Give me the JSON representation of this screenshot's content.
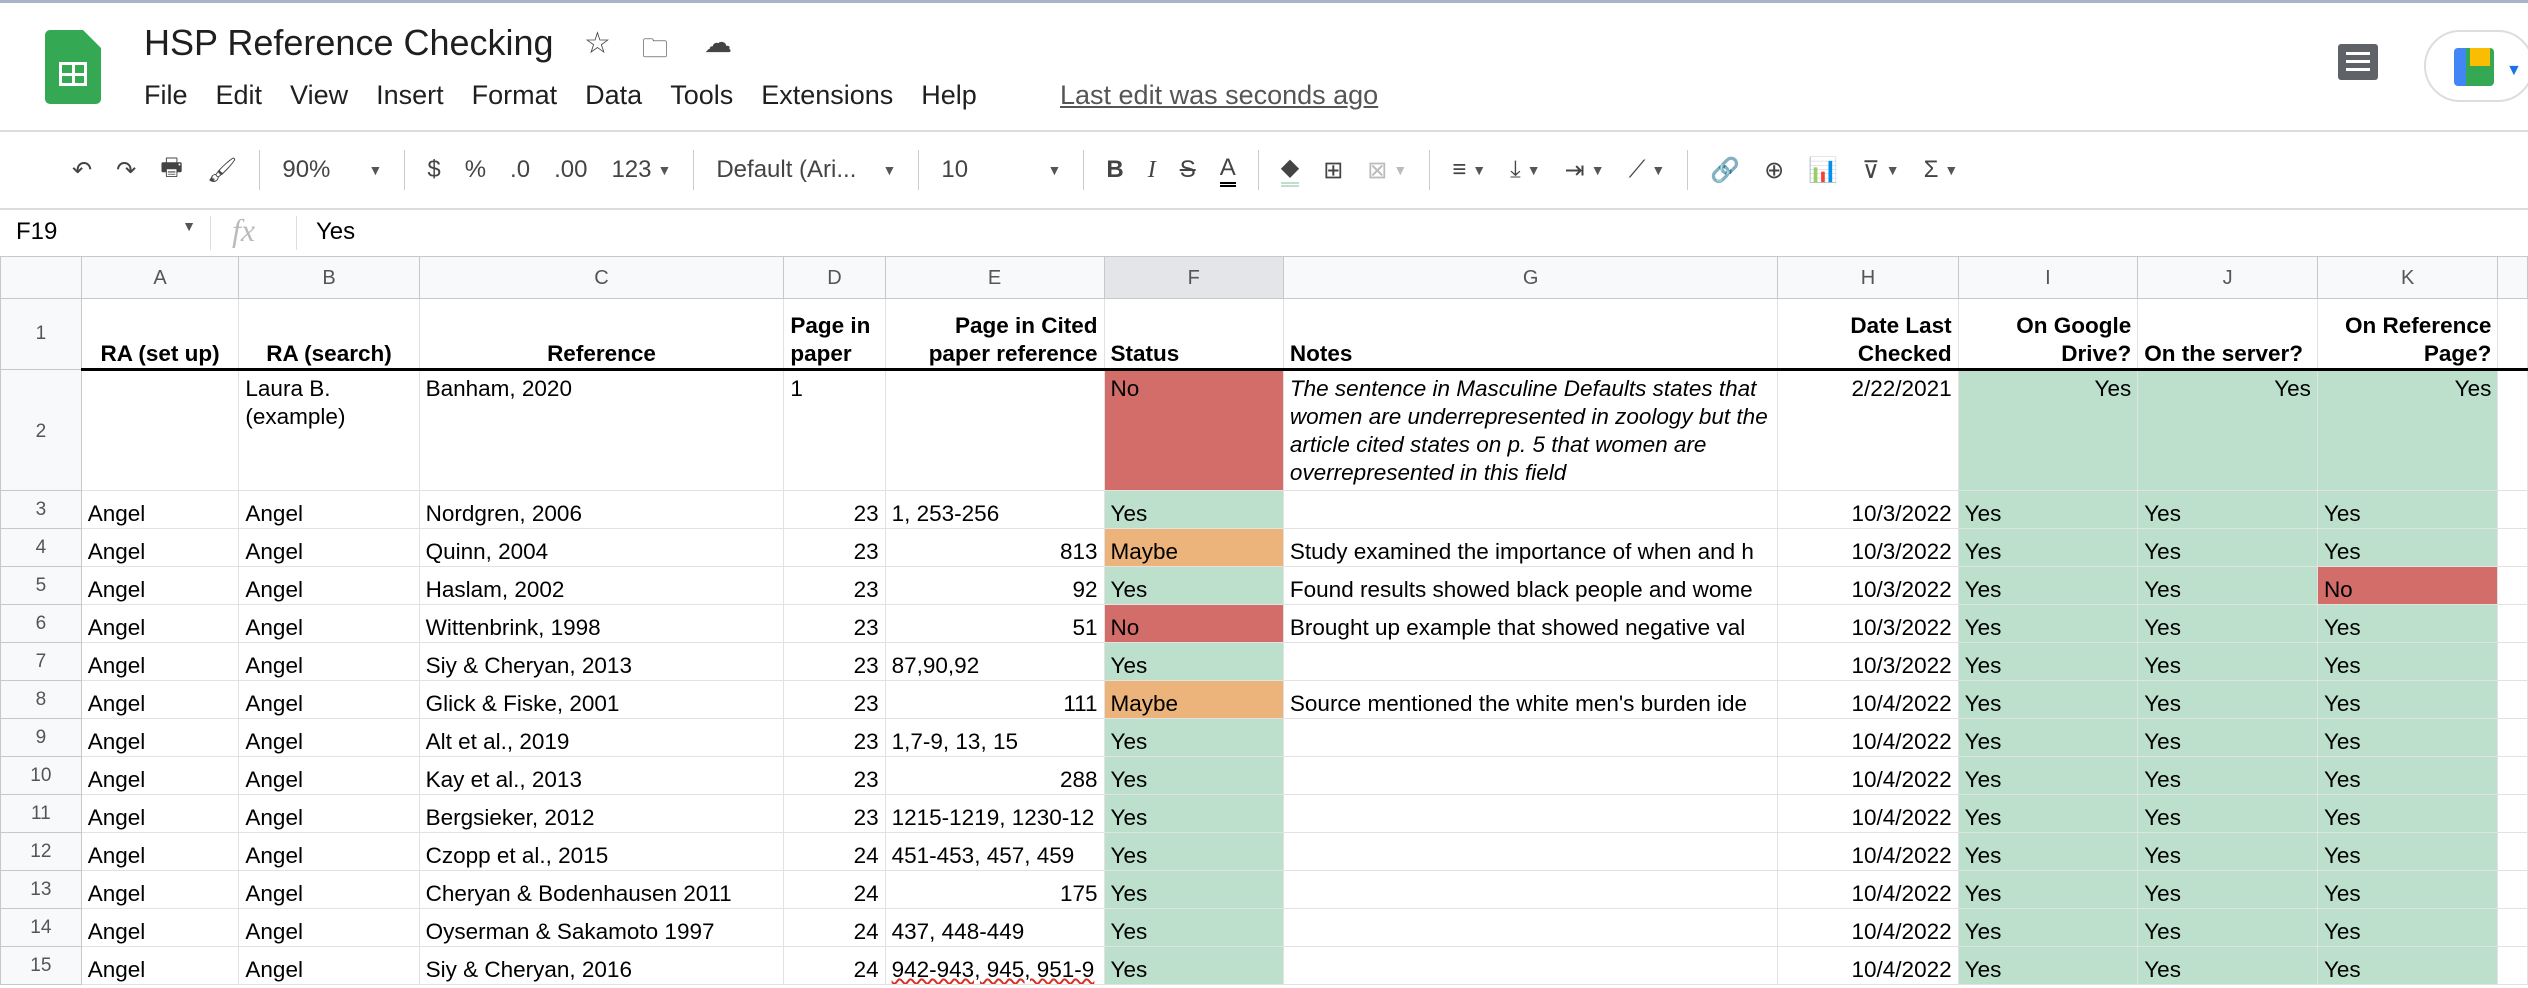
{
  "doc": {
    "title": "HSP Reference Checking",
    "last_edit": "Last edit was seconds ago"
  },
  "menu": [
    "File",
    "Edit",
    "View",
    "Insert",
    "Format",
    "Data",
    "Tools",
    "Extensions",
    "Help"
  ],
  "toolbar": {
    "zoom": "90%",
    "currency": "$",
    "percent": "%",
    "dec_less": ".0",
    "dec_more": ".00",
    "format_more": "123",
    "font": "Default (Ari...",
    "font_size": "10",
    "bold": "B",
    "italic": "I",
    "strike": "S",
    "text_color": "A"
  },
  "formula_bar": {
    "cell_ref": "F19",
    "fx": "fx",
    "value": "Yes"
  },
  "colors": {
    "green": "#bde0cd",
    "red": "#d36d6a",
    "orange": "#ecb47b"
  },
  "columns": [
    "A",
    "B",
    "C",
    "D",
    "E",
    "F",
    "G",
    "H",
    "I",
    "J",
    "K",
    ""
  ],
  "header_row": {
    "num": "1",
    "cells": [
      "RA (set up)",
      "RA (search)",
      "Reference",
      "Page in paper",
      "Page in Cited paper reference",
      "Status",
      "Notes",
      "Date Last Checked",
      "On Google Drive?",
      "On the server?",
      "On Reference Page?",
      ""
    ]
  },
  "example_row": {
    "num": "2",
    "cells": [
      "",
      "Laura B. (example)",
      "Banham, 2020",
      "1",
      "",
      "No",
      "The sentence in Masculine Defaults states that women are underrepresented in zoology but the article cited states on p. 5 that women are overrepresented in this field",
      "2/22/2021",
      "Yes",
      "Yes",
      "Yes",
      ""
    ]
  },
  "rows": [
    {
      "num": "3",
      "cells": [
        "Angel",
        "Angel",
        "Nordgren, 2006",
        "23",
        "1, 253-256",
        "Yes",
        "",
        "10/3/2022",
        "Yes",
        "Yes",
        "Yes"
      ]
    },
    {
      "num": "4",
      "cells": [
        "Angel",
        "Angel",
        "Quinn, 2004",
        "23",
        "813",
        "Maybe",
        "Study examined the importance of when and h",
        "10/3/2022",
        "Yes",
        "Yes",
        "Yes"
      ]
    },
    {
      "num": "5",
      "cells": [
        "Angel",
        "Angel",
        "Haslam, 2002",
        "23",
        "92",
        "Yes",
        "Found results showed black people and wome",
        "10/3/2022",
        "Yes",
        "Yes",
        "No"
      ]
    },
    {
      "num": "6",
      "cells": [
        "Angel",
        "Angel",
        "Wittenbrink, 1998",
        "23",
        "51",
        "No",
        "Brought up example that showed negative val",
        "10/3/2022",
        "Yes",
        "Yes",
        "Yes"
      ]
    },
    {
      "num": "7",
      "cells": [
        "Angel",
        "Angel",
        "Siy & Cheryan, 2013",
        "23",
        "87,90,92",
        "Yes",
        "",
        "10/3/2022",
        "Yes",
        "Yes",
        "Yes"
      ]
    },
    {
      "num": "8",
      "cells": [
        "Angel",
        "Angel",
        "Glick & Fiske, 2001",
        "23",
        "111",
        "Maybe",
        "Source mentioned the white men's burden ide",
        "10/4/2022",
        "Yes",
        "Yes",
        "Yes"
      ]
    },
    {
      "num": "9",
      "cells": [
        "Angel",
        "Angel",
        "Alt et al., 2019",
        "23",
        "1,7-9, 13, 15",
        "Yes",
        "",
        "10/4/2022",
        "Yes",
        "Yes",
        "Yes"
      ]
    },
    {
      "num": "10",
      "cells": [
        "Angel",
        "Angel",
        "Kay et al., 2013",
        "23",
        "288",
        "Yes",
        "",
        "10/4/2022",
        "Yes",
        "Yes",
        "Yes"
      ]
    },
    {
      "num": "11",
      "cells": [
        "Angel",
        "Angel",
        "Bergsieker, 2012",
        "23",
        "1215-1219, 1230-12",
        "Yes",
        "",
        "10/4/2022",
        "Yes",
        "Yes",
        "Yes"
      ]
    },
    {
      "num": "12",
      "cells": [
        "Angel",
        "Angel",
        "Czopp et al., 2015",
        "24",
        "451-453, 457, 459",
        "Yes",
        "",
        "10/4/2022",
        "Yes",
        "Yes",
        "Yes"
      ]
    },
    {
      "num": "13",
      "cells": [
        "Angel",
        "Angel",
        "Cheryan & Bodenhausen 2011",
        "24",
        "175",
        "Yes",
        "",
        "10/4/2022",
        "Yes",
        "Yes",
        "Yes"
      ]
    },
    {
      "num": "14",
      "cells": [
        "Angel",
        "Angel",
        "Oyserman & Sakamoto 1997",
        "24",
        "437, 448-449",
        "Yes",
        "",
        "10/4/2022",
        "Yes",
        "Yes",
        "Yes"
      ]
    },
    {
      "num": "15",
      "cells": [
        "Angel",
        "Angel",
        "Siy & Cheryan, 2016",
        "24",
        "942-943, 945, 951-9",
        "Yes",
        "",
        "10/4/2022",
        "Yes",
        "Yes",
        "Yes"
      ]
    }
  ]
}
